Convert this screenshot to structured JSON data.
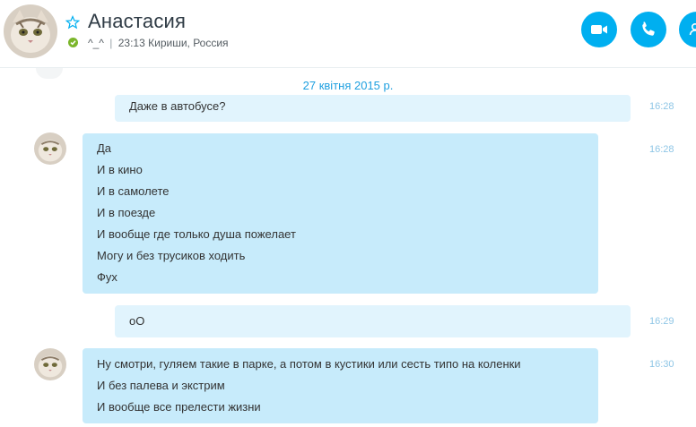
{
  "header": {
    "contact_name": "Анастасия",
    "mood": "^_^",
    "separator": "|",
    "local_time": "23:13",
    "location": "Кириши, Россия",
    "status": "online",
    "status_color": "#7bb62b",
    "accent_color": "#00aff0",
    "icons": [
      "star-icon",
      "video-call-icon",
      "phone-icon",
      "add-contact-icon"
    ]
  },
  "conversation": {
    "date": "27 квітня 2015 р.",
    "messages": [
      {
        "direction": "outgoing",
        "lines": [
          "Даже в автобусе?"
        ],
        "time": "16:28"
      },
      {
        "direction": "incoming",
        "lines": [
          "Да",
          "И в кино",
          "И в самолете",
          "И в поезде",
          "И вообще где только душа пожелает",
          "Могу и без трусиков ходить",
          "Фух"
        ],
        "time": "16:28"
      },
      {
        "direction": "outgoing",
        "lines": [
          "оО"
        ],
        "time": "16:29"
      },
      {
        "direction": "incoming",
        "lines": [
          "Ну смотри, гуляем такие в парке, а потом в кустики или сесть типо на коленки",
          "И без палева и экстрим",
          "И вообще все прелести жизни"
        ],
        "time": "16:30"
      }
    ]
  }
}
